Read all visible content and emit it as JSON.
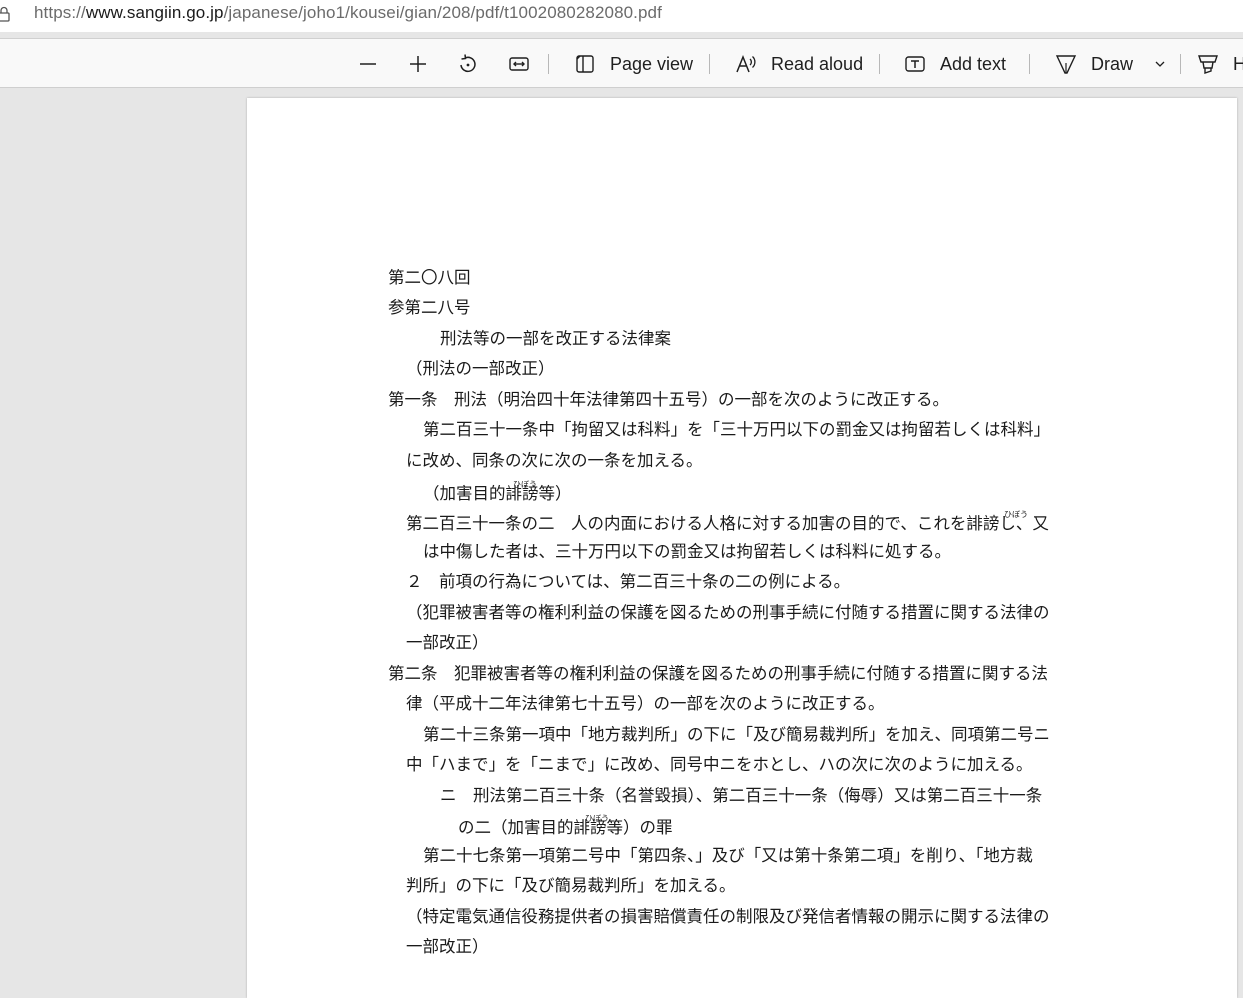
{
  "browser": {
    "url_prefix": "https://",
    "url_host": "www.sangiin.go.jp",
    "url_path": "/japanese/joho1/kousei/gian/208/pdf/t1002080282080.pdf"
  },
  "toolbar": {
    "page_view_label": "Page view",
    "read_aloud_label": "Read aloud",
    "add_text_label": "Add text",
    "draw_label": "Draw",
    "highlight_label": "H"
  },
  "document": {
    "lines": [
      "第二〇八回",
      "参第二八号",
      "刑法等の一部を改正する法律案",
      "（刑法の一部改正）",
      "第一条　刑法（明治四十年法律第四十五号）の一部を次のように改正する。",
      "第二百三十一条中「拘留又は科料」を「三十万円以下の罰金又は拘留若しくは科料」",
      "に改め、同条の次に次の一条を加える。",
      "（加害目的誹謗等）",
      "第二百三十一条の二　人の内面における人格に対する加害の目的で、これを誹謗し、又",
      "は中傷した者は、三十万円以下の罰金又は拘留若しくは科料に処する。",
      "２　前項の行為については、第二百三十条の二の例による。",
      "（犯罪被害者等の権利利益の保護を図るための刑事手続に付随する措置に関する法律の",
      "一部改正）",
      "第二条　犯罪被害者等の権利利益の保護を図るための刑事手続に付随する措置に関する法",
      "律（平成十二年法律第七十五号）の一部を次のように改正する。",
      "第二十三条第一項中「地方裁判所」の下に「及び簡易裁判所」を加え、同項第二号ニ",
      "中「ハまで」を「ニまで」に改め、同号中ニをホとし、ハの次に次のように加える。",
      "ニ　刑法第二百三十条（名誉毀損）、第二百三十一条（侮辱）又は第二百三十一条",
      "の二（加害目的誹謗等）の罪",
      "第二十七条第一項第二号中「第四条、」及び「又は第十条第二項」を削り、「地方裁",
      "判所」の下に「及び簡易裁判所」を加える。",
      "（特定電気通信役務提供者の損害賠償責任の制限及び発信者情報の開示に関する法律の",
      "一部改正）"
    ],
    "ruby_hibou": "ひぼう"
  }
}
